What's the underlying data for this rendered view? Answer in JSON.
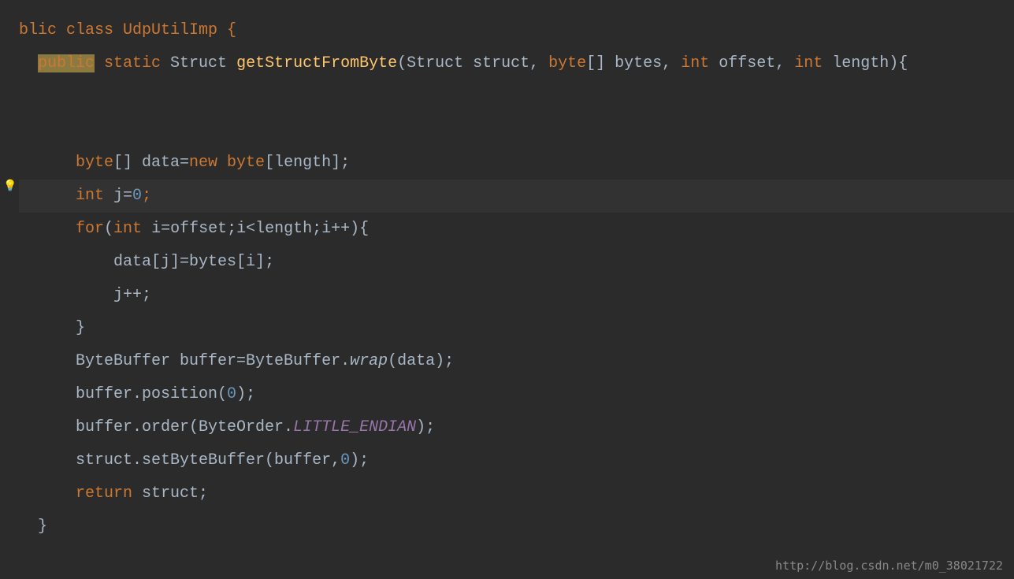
{
  "code": {
    "line1_public": "public",
    "line1_rest": " class UdpUtilImp {",
    "line2_public": "public",
    "line2_static": " static",
    "line2_struct": " Struct ",
    "line2_method": "getStructFromByte",
    "line2_params": "(Struct struct, ",
    "line2_byte": "byte",
    "line2_bytes": "[] bytes, ",
    "line2_int1": "int",
    "line2_offset": " offset, ",
    "line2_int2": "int",
    "line2_length": " length){",
    "line3_byte": "byte",
    "line3_data": "[] data=",
    "line3_new": "new byte",
    "line3_end": "[length];",
    "line4_int": "int",
    "line4_j": " j=",
    "line4_zero": "0",
    "line4_semi": ";",
    "line5_for": "for",
    "line5_open": "(",
    "line5_int": "int",
    "line5_body": " i=offset;i<length;i++){",
    "line6": "data[j]=bytes[i];",
    "line7": "j++;",
    "line8": "}",
    "line9_a": "ByteBuffer buffer=ByteBuffer.",
    "line9_wrap": "wrap",
    "line9_b": "(data);",
    "line10_a": "buffer.position(",
    "line10_zero": "0",
    "line10_b": ");",
    "line11_a": "buffer.order(ByteOrder.",
    "line11_endian": "LITTLE_ENDIAN",
    "line11_b": ");",
    "line12_a": "struct.setByteBuffer(buffer,",
    "line12_zero": "0",
    "line12_b": ");",
    "line13_return": "return",
    "line13_struct": " struct;",
    "line14": "}"
  },
  "watermark": "http://blog.csdn.net/m0_38021722",
  "lightbulb": "💡"
}
